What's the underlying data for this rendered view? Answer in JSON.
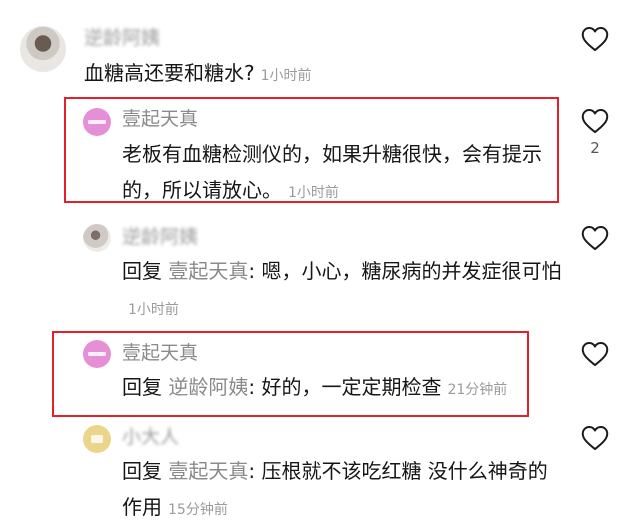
{
  "comments": [
    {
      "username": "逆龄阿姨",
      "text": "血糖高还要和糖水?",
      "time": "1小时前",
      "likes": ""
    },
    {
      "username": "壹起天真",
      "text": "老板有血糖检测仪的，如果升糖很快，会有提示的，所以请放心。",
      "time": "1小时前",
      "likes": "2"
    },
    {
      "username": "逆龄阿姨",
      "reply_prefix": "回复",
      "reply_to": "壹起天真",
      "text": ": 嗯，小心，糖尿病的并发症很可怕",
      "time": "1小时前",
      "likes": ""
    },
    {
      "username": "壹起天真",
      "reply_prefix": "回复",
      "reply_to": "逆龄阿姨",
      "text": ": 好的，一定定期检查",
      "time": "21分钟前",
      "likes": ""
    },
    {
      "username": "小大人",
      "reply_prefix": "回复",
      "reply_to": "壹起天真",
      "text": ": 压根就不该吃红糖 没什么神奇的作用",
      "time": "15分钟前",
      "likes": ""
    }
  ],
  "icons": {
    "like": "heart-outline-icon"
  },
  "colors": {
    "highlight_box": "#e4212a",
    "pink_avatar": "#e58fd6",
    "yellow_avatar": "#ead58a"
  }
}
